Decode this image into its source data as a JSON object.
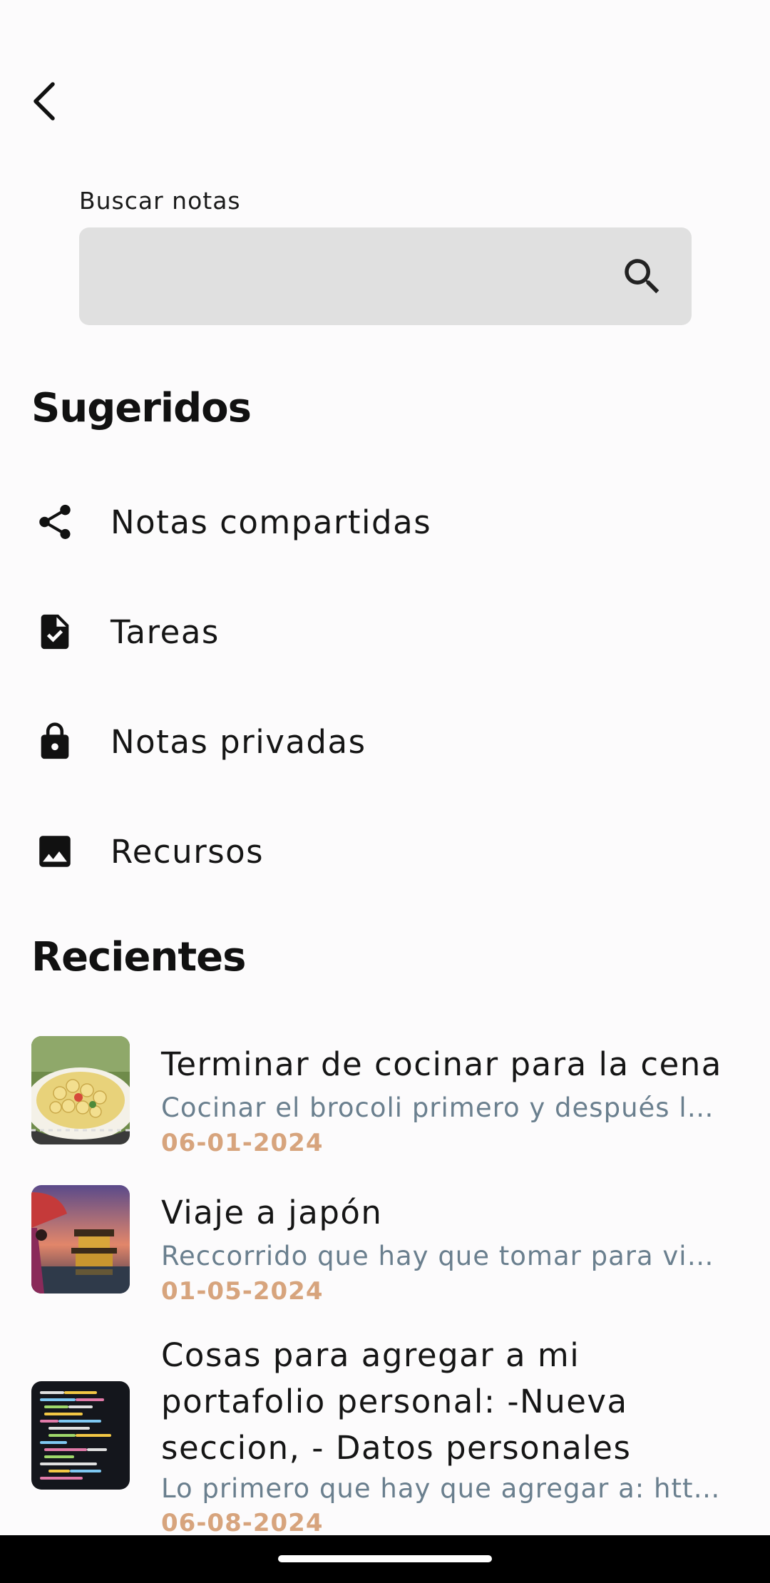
{
  "header": {
    "back_icon": "chevron-left-icon"
  },
  "search": {
    "label": "Buscar notas",
    "value": "",
    "placeholder": "",
    "icon": "search-icon"
  },
  "suggested": {
    "title": "Sugeridos",
    "items": [
      {
        "label": "Notas compartidas",
        "icon": "share-icon"
      },
      {
        "label": "Tareas",
        "icon": "task-file-icon"
      },
      {
        "label": "Notas privadas",
        "icon": "lock-icon"
      },
      {
        "label": "Recursos",
        "icon": "image-icon"
      }
    ]
  },
  "recent": {
    "title": "Recientes",
    "notes": [
      {
        "title": "Terminar de cocinar para la cena",
        "description": "Cocinar el brocoli primero y después l…",
        "date": "06-01-2024",
        "thumbnail": "pasta-photo"
      },
      {
        "title": "Viaje a japón",
        "description": "Reccorrido que hay que tomar para vi…",
        "date": "01-05-2024",
        "thumbnail": "japan-temple-photo"
      },
      {
        "title": "Cosas para agregar a mi portafolio personal: -Nueva seccion, - Datos personales",
        "description": "Lo primero que hay que agregar a: htt…",
        "date": "06-08-2024",
        "thumbnail": "code-screen-photo"
      }
    ]
  },
  "colors": {
    "background": "#fcfbfc",
    "search_field": "#e0e0e0",
    "description_text": "#6a7f8e",
    "date_text": "#d7a47d"
  }
}
